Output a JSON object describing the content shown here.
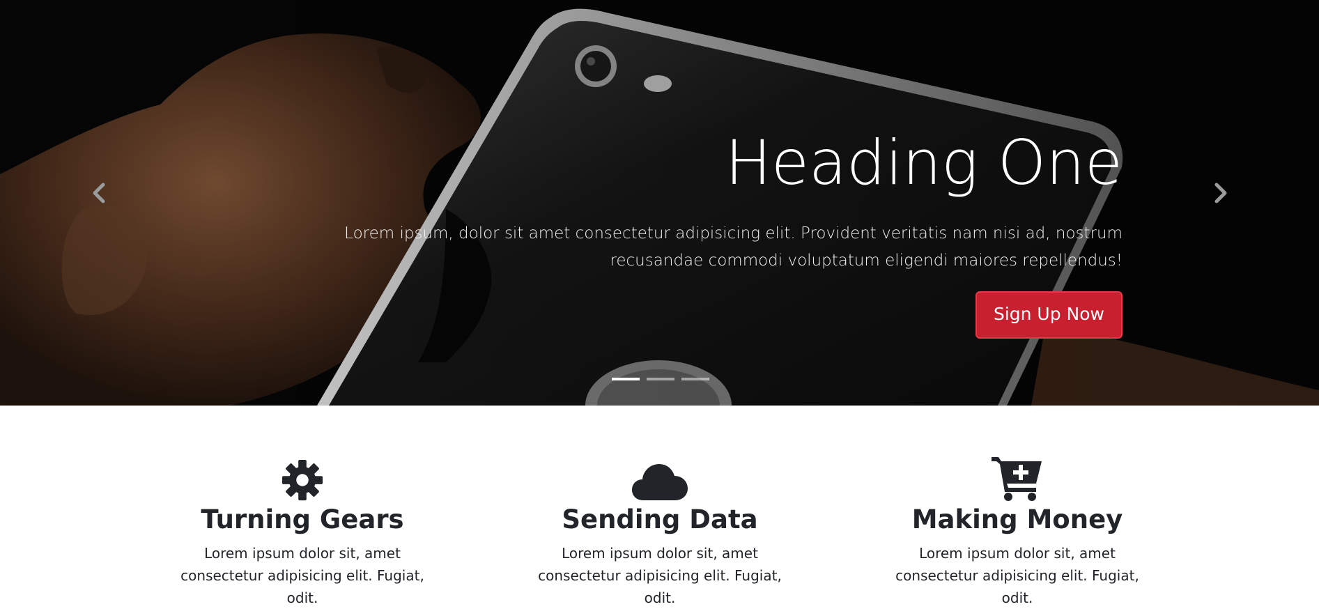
{
  "carousel": {
    "slide": {
      "heading": "Heading One",
      "text": "Lorem ipsum, dolor sit amet consectetur adipisicing elit. Provident veritatis nam nisi ad, nostrum recusandae commodi voluptatum eligendi maiores repellendus!",
      "button_label": "Sign Up Now"
    },
    "prev_icon": "chevron-left-icon",
    "next_icon": "chevron-right-icon",
    "indicator_count": 3,
    "active_indicator": 1
  },
  "features": [
    {
      "icon": "gear-icon",
      "title": "Turning Gears",
      "text": "Lorem ipsum dolor sit, amet consectetur adipisicing elit. Fugiat, odit."
    },
    {
      "icon": "cloud-icon",
      "title": "Sending Data",
      "text": "Lorem ipsum dolor sit, amet consectetur adipisicing elit. Fugiat, odit."
    },
    {
      "icon": "cart-plus-icon",
      "title": "Making Money",
      "text": "Lorem ipsum dolor sit, amet consectetur adipisicing elit. Fugiat, odit."
    }
  ],
  "colors": {
    "primary_button": "#c8202f",
    "hero_background": "#060606",
    "text_dark": "#212529"
  }
}
